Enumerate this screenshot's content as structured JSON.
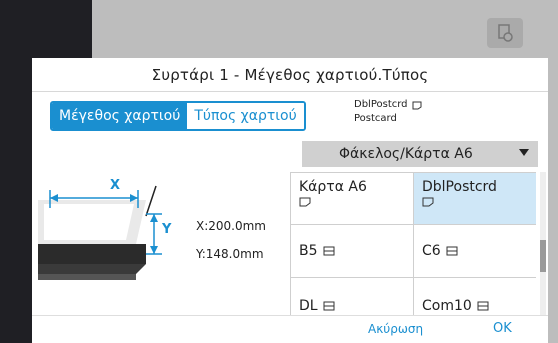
{
  "dialog": {
    "title": "Συρτάρι 1 - Μέγεθος χαρτιού.Τύπος"
  },
  "tabs": {
    "size_label": "Μέγεθος χαρτιού",
    "type_label": "Τύπος χαρτιού",
    "active": "size"
  },
  "info": {
    "line1": "DblPostcrd",
    "line2": "Postcard"
  },
  "dropdown": {
    "value": "Φάκελος/Κάρτα A6"
  },
  "dimensions": {
    "x_axis_label": "X",
    "y_axis_label": "Y",
    "x": "X:200.0mm",
    "y": "Y:148.0mm"
  },
  "grid": {
    "items": [
      {
        "label": "Κάρτα A6",
        "icon": "postcard-icon",
        "selected": false
      },
      {
        "label": "DblPostcrd",
        "icon": "postcard-icon",
        "selected": true
      },
      {
        "label": "B5",
        "icon": "envelope-landscape-icon",
        "selected": false
      },
      {
        "label": "C6",
        "icon": "envelope-landscape-icon",
        "selected": false
      },
      {
        "label": "DL",
        "icon": "envelope-landscape-icon",
        "selected": false
      },
      {
        "label": "Com10",
        "icon": "envelope-landscape-icon",
        "selected": false
      }
    ]
  },
  "buttons": {
    "cancel": "Ακύρωση",
    "ok": "OK"
  },
  "colors": {
    "accent": "#1a8fd0",
    "selected_cell": "#cfe7f7"
  }
}
